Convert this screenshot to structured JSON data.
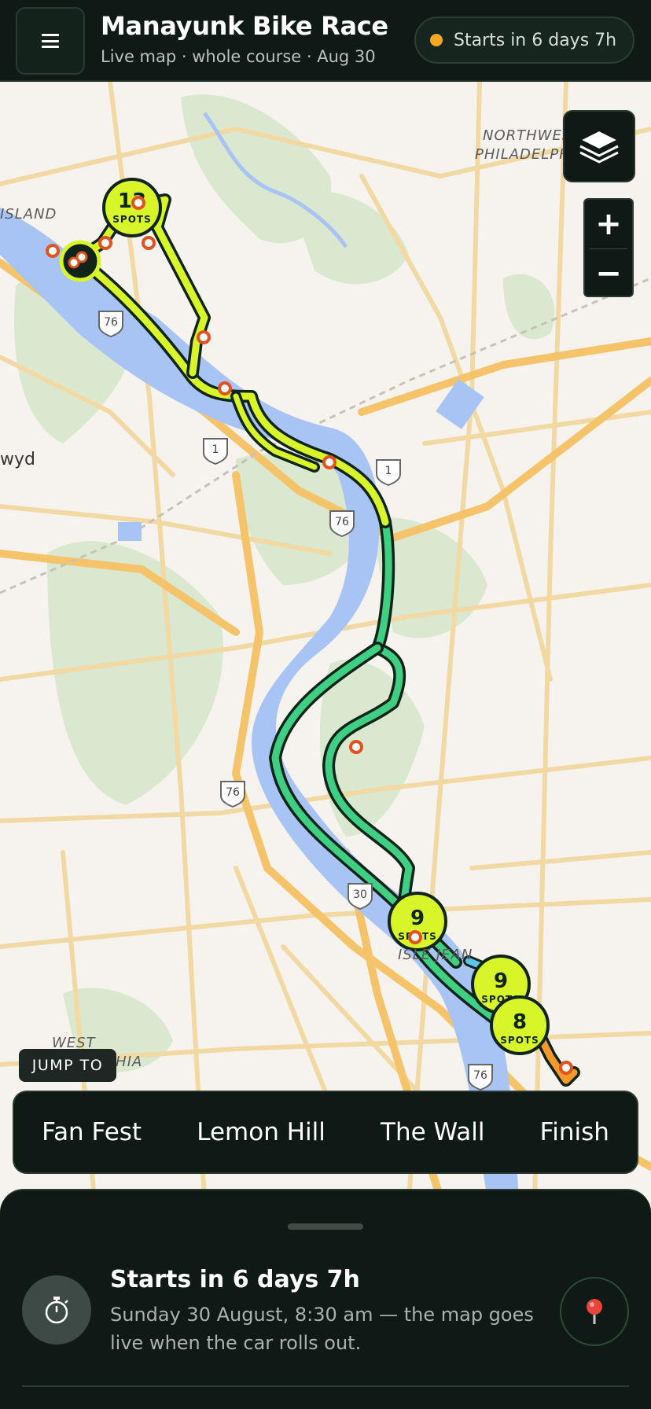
{
  "header": {
    "title": "Manayunk Bike Race",
    "subtitle": "Live map · whole course · Aug 30",
    "status": "Starts in 6 days 7h",
    "status_color": "#f5a623"
  },
  "map": {
    "labels": {
      "island": "ISLAND",
      "northwest": "NORTHWEST",
      "philadelphia": "PHILADELPHIA",
      "wyd": "wyd",
      "isle": "ISLE JEAN",
      "west": "WEST",
      "west_philadelphia": "PHILADELPHIA"
    },
    "route_shields": [
      "76",
      "1",
      "1",
      "76",
      "76",
      "30",
      "76"
    ],
    "clusters": [
      {
        "count": "13",
        "unit": "SPOTS"
      },
      {
        "count": "9",
        "unit": "SPOTS"
      },
      {
        "count": "9",
        "unit": "SPOTS"
      },
      {
        "count": "8",
        "unit": "SPOTS"
      }
    ],
    "colors": {
      "course_lime": "#d8f52a",
      "course_green": "#3ecf83",
      "course_orange": "#f39a2a",
      "river": "#a8c4f4",
      "park": "#d9e8cf"
    }
  },
  "controls": {
    "layers_icon": "layers-icon",
    "zoom_in": "+",
    "zoom_out": "−"
  },
  "jump_to": {
    "label": "JUMP TO",
    "items": [
      "Fan Fest",
      "Lemon Hill",
      "The Wall",
      "Finish"
    ]
  },
  "sheet": {
    "title": "Starts in 6 days 7h",
    "description": "Sunday 30 August, 8:30 am — the map goes live when the car rolls out.",
    "timer_icon": "stopwatch-icon",
    "locate_icon": "pin-icon"
  }
}
